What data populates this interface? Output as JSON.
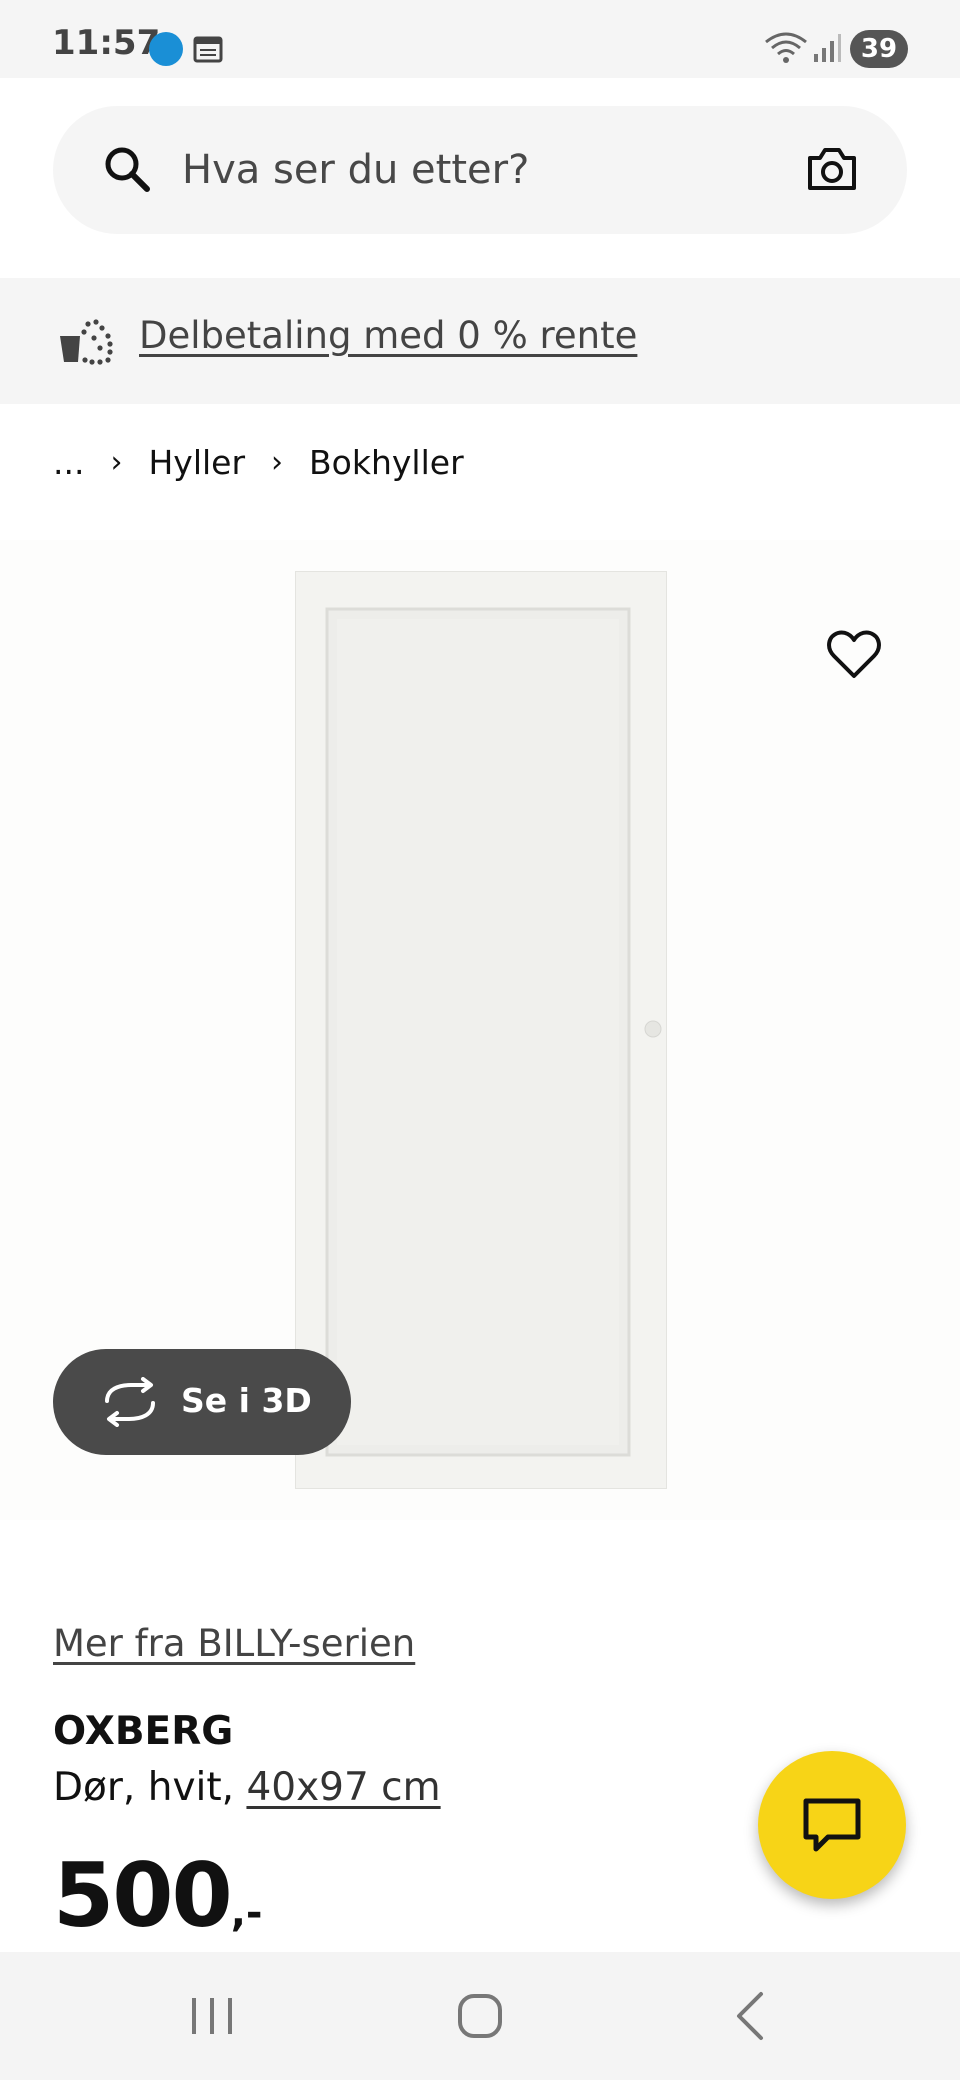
{
  "status_bar": {
    "time": "11:57",
    "battery": "39"
  },
  "search": {
    "placeholder": "Hva ser du etter?"
  },
  "promo": {
    "text": "Delbetaling med 0 % rente"
  },
  "breadcrumb": {
    "ellipsis": "...",
    "items": [
      "Hyller",
      "Bokhyller"
    ]
  },
  "gallery": {
    "see_3d_label": "Se i 3D"
  },
  "product": {
    "series_link": "Mer fra BILLY-serien",
    "name": "OXBERG",
    "description": "Dør, hvit,",
    "size": "40x97 cm",
    "price": "500",
    "price_suffix": ",-"
  },
  "colors": {
    "chat_button": "#f7d417",
    "see_3d_button": "#4a4a4a",
    "surface_gray": "#f5f5f5"
  },
  "icons": {
    "search": "search-icon",
    "camera": "camera-icon",
    "promo": "payment-bag-icon",
    "favorite": "heart-icon",
    "rotate": "rotate-3d-icon",
    "chat": "chat-icon"
  }
}
